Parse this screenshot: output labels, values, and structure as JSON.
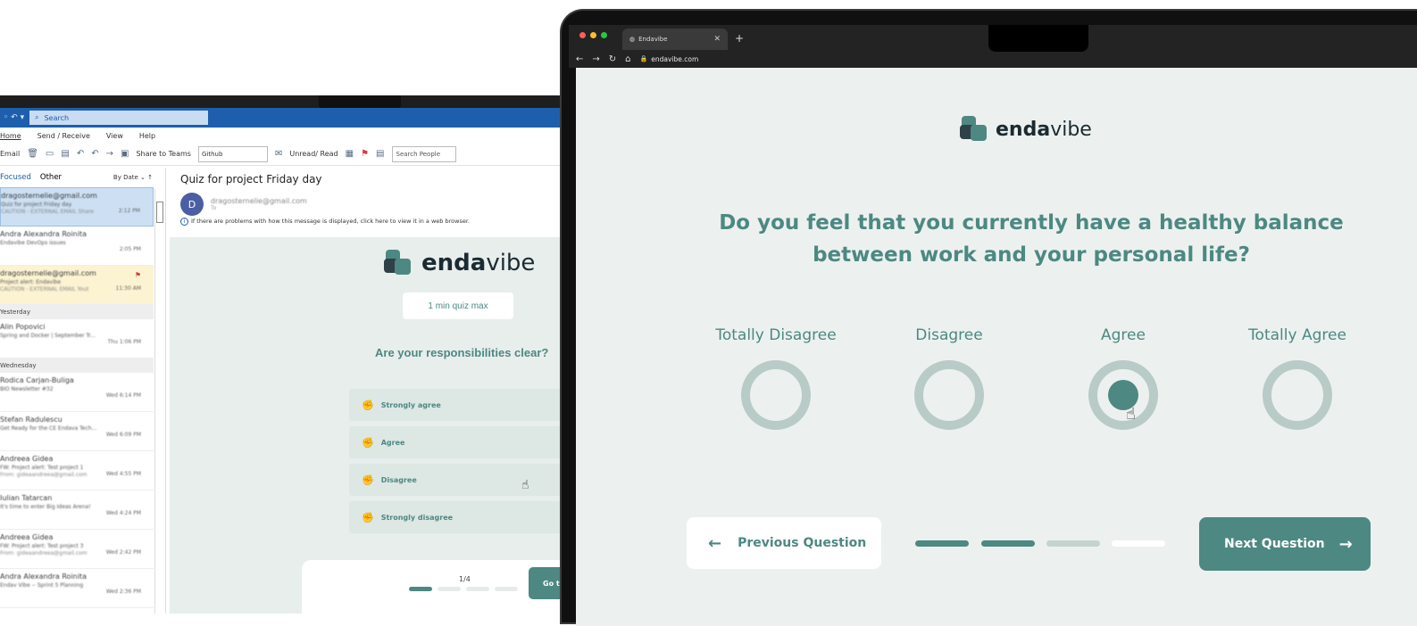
{
  "outlook": {
    "search_label": "Search",
    "menu": [
      "Home",
      "Send / Receive",
      "View",
      "Help"
    ],
    "toolbar": {
      "new_email": "Email",
      "share_to_teams": "Share to Teams",
      "move_target": "Github",
      "unread_read": "Unread/ Read",
      "search_people_placeholder": "Search People"
    },
    "list": {
      "tab_focused": "Focused",
      "tab_other": "Other",
      "sort": "By Date",
      "groups": {
        "yesterday": "Yesterday",
        "wednesday": "Wednesday"
      },
      "mails_top": [
        {
          "from": "dragosternelie@gmail.com",
          "subject": "Quiz for project Friday day",
          "preview": "CAUTION - EXTERNAL EMAIL Share",
          "time": "2:12 PM"
        },
        {
          "from": "Andra Alexandra Roinita",
          "subject": "Endavibe DevOps issues",
          "preview": "",
          "time": "2:05 PM"
        },
        {
          "from": "dragosternelie@gmail.com",
          "subject": "Project alert: Endavibe",
          "preview": "CAUTION - EXTERNAL EMAIL Yout",
          "time": "11:30 AM"
        }
      ],
      "mails_yesterday": [
        {
          "from": "Alin Popovici",
          "subject": "Spring and Docker | September Tr...",
          "preview": "",
          "time": "Thu 1:06 PM"
        }
      ],
      "mails_wednesday": [
        {
          "from": "Rodica Carjan-Buliga",
          "subject": "BIO Newsletter #32",
          "preview": "",
          "time": "Wed 6:14 PM"
        },
        {
          "from": "Stefan Radulescu",
          "subject": "Get Ready for the CE Endava Tech...",
          "preview": "",
          "time": "Wed 6:09 PM"
        },
        {
          "from": "Andreea Gidea",
          "subject": "FW: Project alert: Test project 1",
          "preview": "From: gideaandreea@gmail.com",
          "time": "Wed 4:55 PM"
        },
        {
          "from": "Iulian Tatarcan",
          "subject": "It's time to enter Big Ideas Arena!",
          "preview": "",
          "time": "Wed 4:24 PM"
        },
        {
          "from": "Andreea Gidea",
          "subject": "FW: Project alert: Test project 3",
          "preview": "From: gideaandreea@gmail.com",
          "time": "Wed 2:42 PM"
        },
        {
          "from": "Andra Alexandra Roinita",
          "subject": "Endav Vibe -- Sprint 5 Planning",
          "preview": "",
          "time": "Wed 2:36 PM"
        }
      ]
    },
    "reading": {
      "subject": "Quiz for project Friday day",
      "avatar_letter": "D",
      "sender": "dragosternelie@gmail.com",
      "to": "To",
      "info": "If there are problems with how this message is displayed, click here to view it in a web browser.",
      "brand_bold": "enda",
      "brand_light": "vibe",
      "pill": "1 min quiz max",
      "question": "Are your responsibilities clear?",
      "options": [
        "Strongly agree",
        "Agree",
        "Disagree",
        "Strongly disagree"
      ],
      "counter": "1/4",
      "go_button": "Go t"
    }
  },
  "browser": {
    "tab_title": "Endavibe",
    "url": "endavibe.com",
    "page": {
      "brand_bold": "enda",
      "brand_light": "vibe",
      "question": "Do you feel that you currently have a healthy balance between work and your personal life?",
      "choices": [
        "Totally Disagree",
        "Disagree",
        "Agree",
        "Totally Agree"
      ],
      "selected_choice": "Agree",
      "prev_button": "Previous Question",
      "next_button": "Next Question",
      "progress_steps_done": 2,
      "progress_steps_total": 4
    }
  },
  "colors": {
    "accent": "#4d8882",
    "ring": "#b8cbc7",
    "page_bg": "#ecf1ef",
    "outlook_blue": "#1d5fad"
  }
}
